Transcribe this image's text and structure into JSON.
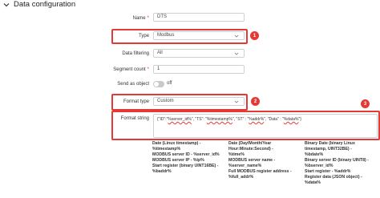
{
  "section": {
    "title": "Data configuration"
  },
  "fields": {
    "name": {
      "label": "Name",
      "value": "DTS"
    },
    "type": {
      "label": "Type",
      "value": "Modbus"
    },
    "data_filtering": {
      "label": "Data filtering",
      "value": "All"
    },
    "segment_count": {
      "label": "Segment count",
      "value": "1"
    },
    "send_as_object": {
      "label": "Send as object",
      "state": "off"
    },
    "format_type": {
      "label": "Format type",
      "value": "Custom"
    },
    "format_string": {
      "label": "Format string",
      "value_pre": "{\"ID\":\"",
      "value_sq1": "%server_id%",
      "value_mid1": "\", \"TS\": \"",
      "value_sq2": "%timestamp%",
      "value_mid2": "\", \"ST\" : \"",
      "value_sq3": "%addr%",
      "value_mid3": "\", \"Data\" : \"",
      "value_sq4": "%data%",
      "value_post": "\"}"
    }
  },
  "badges": [
    "1",
    "2",
    "3"
  ],
  "help": [
    "Date (Linux timestamp) -",
    "Date (Day/Month/Year",
    "Binary Date (binary Linux",
    "%timestamp%",
    "Hour:Minute:Second) -",
    "timestamp, UINT32BE) -",
    "MODBUS server ID - %server_id%",
    "%time%",
    "%bdate%",
    "MODBUS server IP - %ip%",
    "MODBUS server name -",
    "Binary server ID (binary UINT8) -",
    "Start register (binary UINT16BE) -",
    "%server_name%",
    "%bserver_id%",
    "%baddr%",
    "Full MODBUS register address -",
    "Start register - %addr%",
    "",
    "%full_addr%",
    "Register data (JSON object) -",
    "",
    "",
    "%data%"
  ],
  "colors": {
    "highlight": "#e53935",
    "toggle_off": "#c9c9c9"
  }
}
